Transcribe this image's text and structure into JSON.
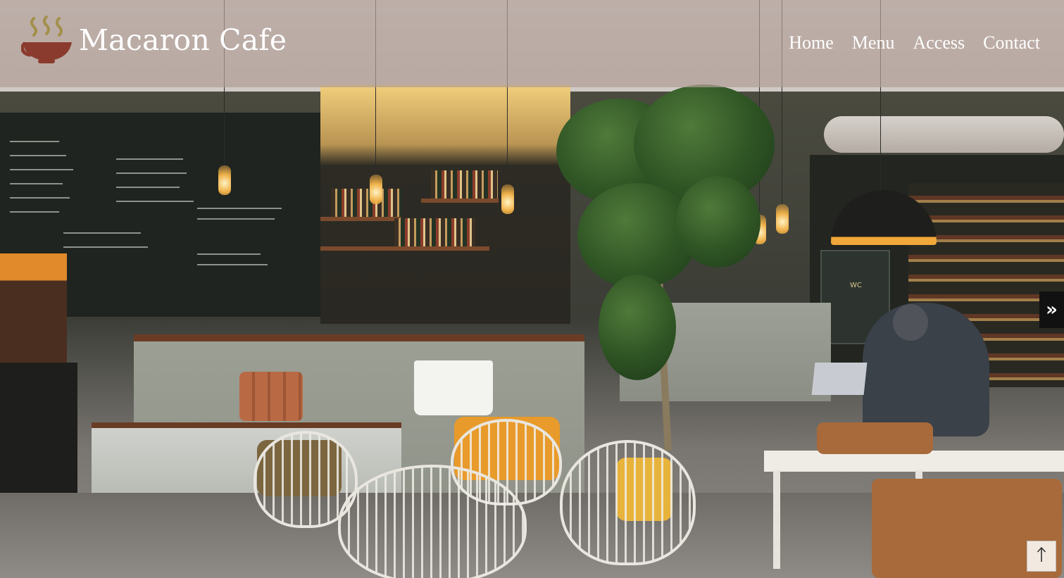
{
  "site": {
    "name": "Macaron Cafe",
    "logo_icon": "coffee-cup-icon"
  },
  "nav": {
    "items": [
      {
        "label": "Home"
      },
      {
        "label": "Menu"
      },
      {
        "label": "Access"
      },
      {
        "label": "Contact"
      }
    ]
  },
  "side_toggle": {
    "label": "»"
  },
  "back_to_top": {
    "icon": "arrow-up-icon"
  },
  "colors": {
    "header_overlay": "#b09c96",
    "logo_cup": "#8a3b2e",
    "logo_steam": "#a2904a",
    "nav_text": "#ffffff",
    "side_toggle_bg": "#111111"
  }
}
